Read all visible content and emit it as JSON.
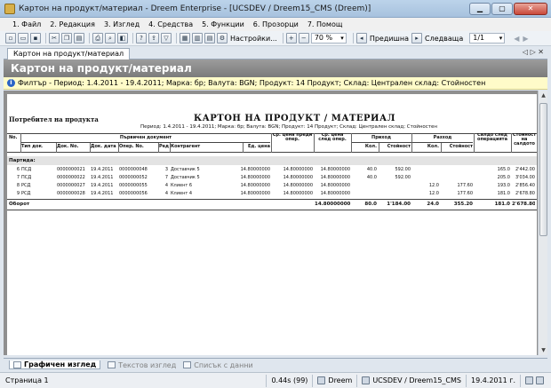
{
  "window": {
    "title": "Картон на продукт/материал - Dreem Enterprise - [UCSDEV / Dreem15_CMS (Dreem)]"
  },
  "menu": [
    "1. Файл",
    "2. Редакция",
    "3. Изглед",
    "4. Средства",
    "5. Функции",
    "6. Прозорци",
    "7. Помощ"
  ],
  "toolbar": {
    "settings_label": "Настройки...",
    "zoom_value": "70 %",
    "prev_label": "Предишна",
    "next_label": "Следваща",
    "page_value": "1/1"
  },
  "doc_tab": {
    "label": "Картон на продукт/материал",
    "controls": "◁ ▷ ✕"
  },
  "header": {
    "title": "Картон на продукт/материал"
  },
  "filter": {
    "text": "Филтър - Период: 1.4.2011 - 19.4.2011; Марка: бр; Валута: BGN; Продукт: 14 Продукт; Склад: Централен склад: Стойностен"
  },
  "report": {
    "left_title": "Потребител на продукта",
    "title": "КАРТОН НА ПРОДУКТ / МАТЕРИАЛ",
    "subtitle": "Период: 1.4.2011 - 19.4.2011; Марка: бр; Валута: BGN; Продукт: 14 Продукт; Склад: Централен склад; Стойностен",
    "headers_top": {
      "no": "No.",
      "primary_doc": "Първичен документ",
      "avg_before": "Ср. цена преди опер.",
      "avg_after": "Ср. цена след опер.",
      "income": "Приход",
      "expense": "Разход",
      "balance_after": "Салдо след операцията",
      "value_balance": "Стойност на салдото"
    },
    "headers_sub": {
      "doc_type": "Тип док.",
      "doc_no": "Док. No.",
      "doc_date": "Док. дата",
      "oper_no": "Опер. No.",
      "row": "Ред",
      "contractor": "Контрагент",
      "unit_price": "Ед. цена",
      "qty_in": "Кол.",
      "value_in": "Стойност",
      "qty_out": "Кол.",
      "value_out": "Стойност"
    },
    "group_label": "Партида:",
    "rows": [
      {
        "no": "6",
        "type": "ПСД",
        "doc_no": "0000000021",
        "date": "19.4.2011",
        "oper": "0000000048",
        "row": "3",
        "contractor": "Доставчик 5",
        "unit_price": "14.80000000",
        "avg_before": "14.80000000",
        "avg_after": "14.80000000",
        "qty_in": "40.0",
        "val_in": "592.00",
        "qty_out": "",
        "val_out": "",
        "bal": "165.0",
        "val_bal": "2'442.00"
      },
      {
        "no": "7",
        "type": "ПСД",
        "doc_no": "0000000022",
        "date": "19.4.2011",
        "oper": "0000000052",
        "row": "7",
        "contractor": "Доставчик 5",
        "unit_price": "14.80000000",
        "avg_before": "14.80000000",
        "avg_after": "14.80000000",
        "qty_in": "40.0",
        "val_in": "592.00",
        "qty_out": "",
        "val_out": "",
        "bal": "205.0",
        "val_bal": "3'034.00"
      },
      {
        "no": "8",
        "type": "РСД",
        "doc_no": "0000000027",
        "date": "19.4.2011",
        "oper": "0000000055",
        "row": "4",
        "contractor": "Клиент 6",
        "unit_price": "14.80000000",
        "avg_before": "14.80000000",
        "avg_after": "14.80000000",
        "qty_in": "",
        "val_in": "",
        "qty_out": "12.0",
        "val_out": "177.60",
        "bal": "193.0",
        "val_bal": "2'856.40"
      },
      {
        "no": "9",
        "type": "РСД",
        "doc_no": "0000000028",
        "date": "19.4.2011",
        "oper": "0000000056",
        "row": "4",
        "contractor": "Клиент 4",
        "unit_price": "14.80000000",
        "avg_before": "14.80000000",
        "avg_after": "14.80000000",
        "qty_in": "",
        "val_in": "",
        "qty_out": "12.0",
        "val_out": "177.60",
        "bal": "181.0",
        "val_bal": "2'678.80"
      }
    ],
    "total": {
      "label": "Оборот",
      "avg_after": "14.80000000",
      "qty_in": "80.0",
      "val_in": "1'184.00",
      "qty_out": "24.0",
      "val_out": "355.20",
      "bal": "181.0",
      "val_bal": "2'678.80"
    }
  },
  "bottom_tabs": [
    "Графичен изглед",
    "Текстов изглед",
    "Списък с данни"
  ],
  "status": {
    "page": "Страница 1",
    "time": "0.44s (99)",
    "app": "Dreem",
    "db": "UCSDEV / Dreem15_CMS",
    "date": "19.4.2011 г."
  }
}
